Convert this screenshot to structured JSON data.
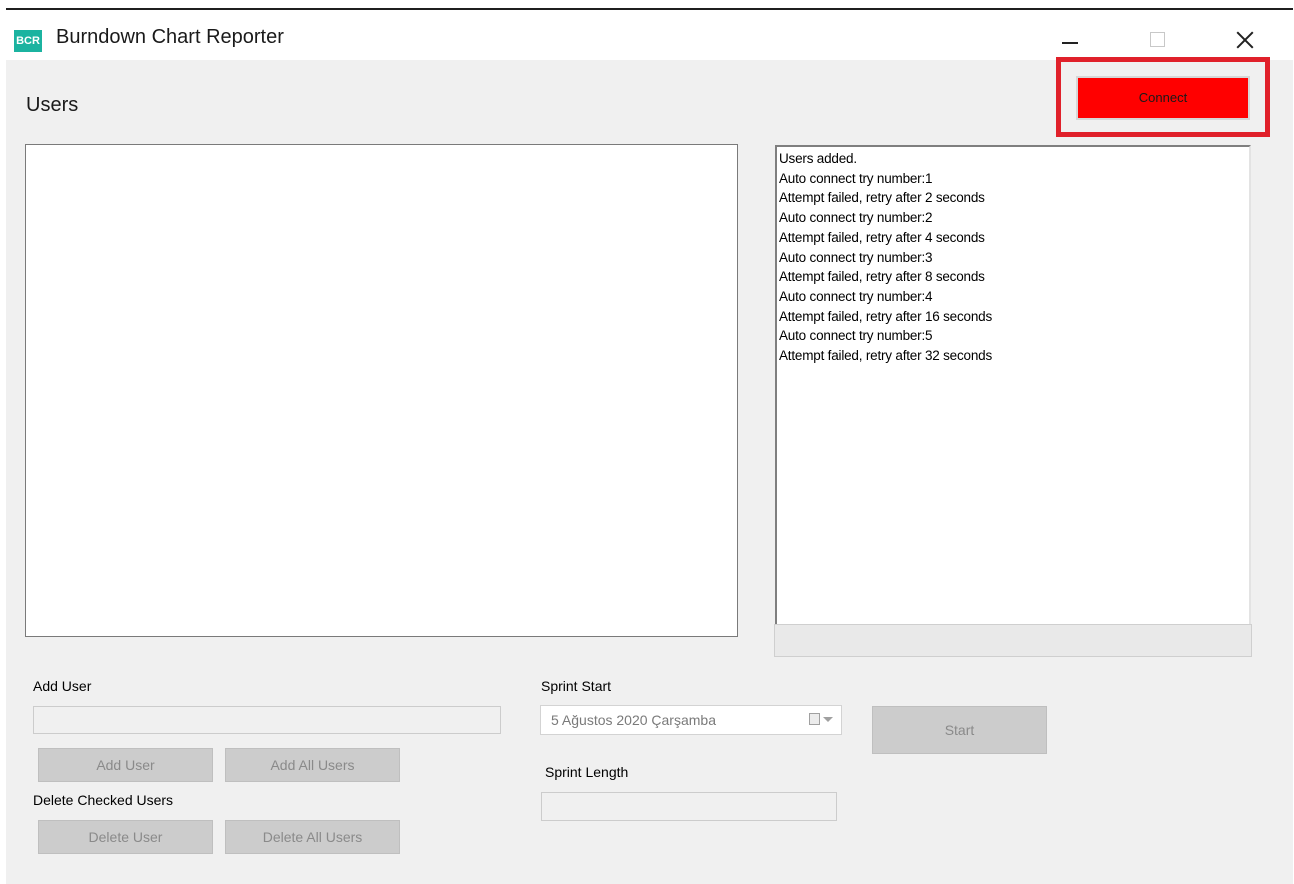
{
  "window": {
    "title": "Burndown Chart Reporter",
    "app_icon_text": "BCR"
  },
  "users": {
    "heading": "Users"
  },
  "connect": {
    "label": "Connect",
    "color": "#ff0000",
    "highlight_color": "#e0202a"
  },
  "log": {
    "lines": [
      "Users added.",
      "Auto connect try number:1",
      "Attempt failed, retry after 2 seconds",
      "Auto connect try number:2",
      "Attempt failed, retry after 4 seconds",
      "Auto connect try number:3",
      "Attempt failed, retry after 8 seconds",
      "Auto connect try number:4",
      "Attempt failed, retry after 16 seconds",
      "Auto connect try number:5",
      "Attempt failed, retry after 32 seconds"
    ]
  },
  "add_user": {
    "label": "Add User",
    "input_value": "",
    "add_button": "Add User",
    "add_all_button": "Add All Users"
  },
  "delete_users": {
    "label": "Delete Checked Users",
    "delete_button": "Delete User",
    "delete_all_button": "Delete All Users"
  },
  "sprint": {
    "start_label": "Sprint Start",
    "start_value": "5 Ağustos 2020 Çarşamba",
    "length_label": "Sprint Length",
    "length_value": "",
    "start_button": "Start"
  }
}
